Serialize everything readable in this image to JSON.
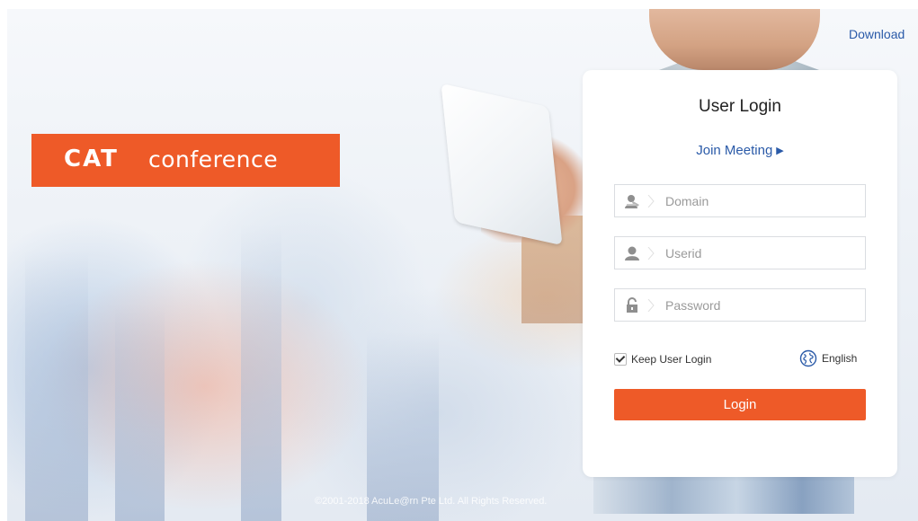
{
  "header": {
    "download_label": "Download"
  },
  "logo": {
    "brand": "CAT",
    "word": "conference"
  },
  "login": {
    "title": "User Login",
    "join_meeting_label": "Join Meeting",
    "join_arrow": "▶",
    "domain_placeholder": "Domain",
    "userid_placeholder": "Userid",
    "password_placeholder": "Password",
    "keep_login_label": "Keep User Login",
    "keep_login_checked": true,
    "language_label": "English",
    "login_button_label": "Login"
  },
  "footer": {
    "copyright": "©2001-2018 AcuLe@rn Pte Ltd. All Rights Reserved."
  },
  "colors": {
    "accent": "#ee5a28",
    "link": "#2a5aa8"
  },
  "icons": {
    "domain": "domain-user-icon",
    "userid": "user-icon",
    "password": "lock-icon",
    "language": "globe-icon"
  }
}
